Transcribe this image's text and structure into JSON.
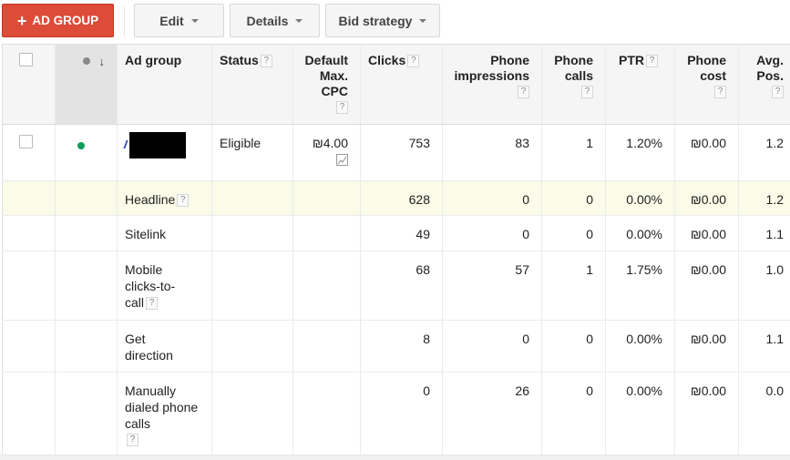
{
  "toolbar": {
    "add_button": {
      "icon": "plus-icon",
      "label": "AD GROUP"
    },
    "edit_label": "Edit",
    "details_label": "Details",
    "bid_strategy_label": "Bid strategy"
  },
  "colors": {
    "primary_button": "#dd4b39",
    "eligible_dot": "#0f9d58",
    "highlight_row": "#fafbe8",
    "header_bg": "#f5f5f5"
  },
  "table": {
    "columns": [
      {
        "key": "select",
        "label": ""
      },
      {
        "key": "status_dot",
        "label": "",
        "icons": [
          "status-dot-icon",
          "sort-down-arrow-icon"
        ]
      },
      {
        "key": "ad_group",
        "label": "Ad group",
        "help": false
      },
      {
        "key": "status",
        "label": "Status",
        "help": true
      },
      {
        "key": "default_max_cpc",
        "label": "Default Max. CPC",
        "lines": [
          "Default",
          "Max.",
          "CPC"
        ],
        "help": true
      },
      {
        "key": "clicks",
        "label": "Clicks",
        "help": true
      },
      {
        "key": "phone_impressions",
        "label": "Phone impressions",
        "lines": [
          "Phone",
          "impressions"
        ],
        "help": true
      },
      {
        "key": "phone_calls",
        "label": "Phone calls",
        "lines": [
          "Phone",
          "calls"
        ],
        "help": true
      },
      {
        "key": "ptr",
        "label": "PTR",
        "help": true
      },
      {
        "key": "phone_cost",
        "label": "Phone cost",
        "lines": [
          "Phone",
          "cost"
        ],
        "help": true
      },
      {
        "key": "avg_pos",
        "label": "Avg. Pos.",
        "lines": [
          "Avg.",
          "Pos."
        ],
        "help": true
      }
    ],
    "help_glyph": "?",
    "main_row": {
      "ad_group": "[redacted]",
      "status": "Eligible",
      "default_max_cpc": "₪4.00",
      "clicks": "753",
      "phone_impressions": "83",
      "phone_calls": "1",
      "ptr": "1.20%",
      "phone_cost": "₪0.00",
      "avg_pos": "1.2"
    },
    "segment_rows": [
      {
        "label": "Headline",
        "help": true,
        "clicks": "628",
        "phone_impressions": "0",
        "phone_calls": "0",
        "ptr": "0.00%",
        "phone_cost": "₪0.00",
        "avg_pos": "1.2",
        "highlighted": true
      },
      {
        "label": "Sitelink",
        "help": false,
        "clicks": "49",
        "phone_impressions": "0",
        "phone_calls": "0",
        "ptr": "0.00%",
        "phone_cost": "₪0.00",
        "avg_pos": "1.1"
      },
      {
        "label": "Mobile clicks-to-call",
        "help": true,
        "clicks": "68",
        "phone_impressions": "57",
        "phone_calls": "1",
        "ptr": "1.75%",
        "phone_cost": "₪0.00",
        "avg_pos": "1.0"
      },
      {
        "label": "Get direction",
        "help": false,
        "clicks": "8",
        "phone_impressions": "0",
        "phone_calls": "0",
        "ptr": "0.00%",
        "phone_cost": "₪0.00",
        "avg_pos": "1.1"
      },
      {
        "label": "Manually dialed phone calls",
        "help": true,
        "clicks": "0",
        "phone_impressions": "26",
        "phone_calls": "0",
        "ptr": "0.00%",
        "phone_cost": "₪0.00",
        "avg_pos": "0.0"
      }
    ]
  }
}
